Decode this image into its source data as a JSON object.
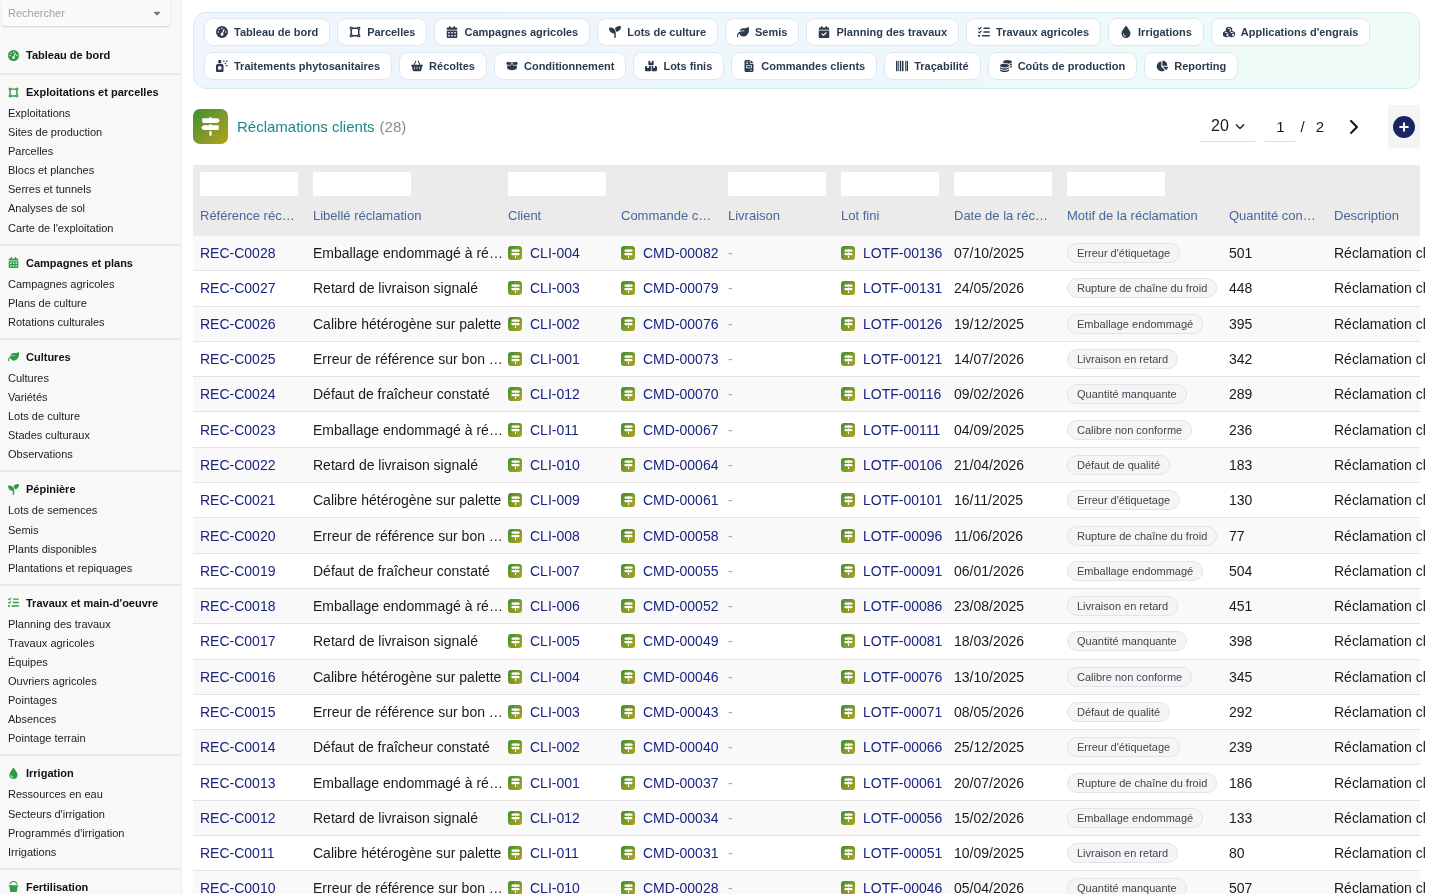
{
  "sidebar": {
    "search": {
      "placeholder": "Rechercher"
    },
    "sections": [
      {
        "title": "Tableau de bord"
      },
      {
        "title": "Exploitations et parcelles",
        "items": [
          {
            "label": "Exploitations",
            "selected": false
          },
          {
            "label": "Sites de production",
            "selected": false
          },
          {
            "label": "Parcelles",
            "selected": false
          },
          {
            "label": "Blocs et planches",
            "selected": false
          },
          {
            "label": "Serres et tunnels",
            "selected": false
          },
          {
            "label": "Analyses de sol",
            "selected": false
          },
          {
            "label": "Carte de l'exploitation",
            "selected": false
          }
        ]
      },
      {
        "title": "Campagnes et plans",
        "items": [
          {
            "label": "Campagnes agricoles",
            "selected": false
          },
          {
            "label": "Plans de culture",
            "selected": false
          },
          {
            "label": "Rotations culturales",
            "selected": false
          }
        ]
      },
      {
        "title": "Cultures",
        "items": [
          {
            "label": "Cultures",
            "selected": false
          },
          {
            "label": "Variétés",
            "selected": false
          },
          {
            "label": "Lots de culture",
            "selected": false
          },
          {
            "label": "Stades culturaux",
            "selected": false
          },
          {
            "label": "Observations",
            "selected": false
          }
        ]
      },
      {
        "title": "Pépinière",
        "items": [
          {
            "label": "Lots de semences",
            "selected": false
          },
          {
            "label": "Semis",
            "selected": false
          },
          {
            "label": "Plants disponibles",
            "selected": false
          },
          {
            "label": "Plantations et repiquages",
            "selected": false
          }
        ]
      },
      {
        "title": "Travaux et main-d'oeuvre",
        "items": [
          {
            "label": "Planning des travaux",
            "selected": false
          },
          {
            "label": "Travaux agricoles",
            "selected": false
          },
          {
            "label": "Équipes",
            "selected": false
          },
          {
            "label": "Ouvriers agricoles",
            "selected": false
          },
          {
            "label": "Pointages",
            "selected": false
          },
          {
            "label": "Absences",
            "selected": false
          },
          {
            "label": "Pointage terrain",
            "selected": false
          }
        ]
      },
      {
        "title": "Irrigation",
        "items": [
          {
            "label": "Ressources en eau",
            "selected": false
          },
          {
            "label": "Secteurs d'irrigation",
            "selected": false
          },
          {
            "label": "Programmés d'irrigation",
            "selected": false
          },
          {
            "label": "Irrigations",
            "selected": false
          }
        ]
      },
      {
        "title": "Fertilisation"
      }
    ]
  },
  "module_tabs": {
    "rows": [
      {
        "tabs": [
          {
            "label": "Tableau de bord",
            "selected": false
          },
          {
            "label": "Parcelles",
            "selected": false
          },
          {
            "label": "Campagnes agricoles",
            "selected": false
          },
          {
            "label": "Lots de culture",
            "selected": false
          },
          {
            "label": "Semis",
            "selected": false
          },
          {
            "label": "Planning des travaux",
            "selected": false
          },
          {
            "label": "Travaux agricoles",
            "selected": false
          },
          {
            "label": "Irrigations",
            "selected": false
          },
          {
            "label": "Applications d'engrais",
            "selected": false
          }
        ]
      },
      {
        "tabs": [
          {
            "label": "Traitements phytosanitaires",
            "selected": false
          },
          {
            "label": "Récoltes",
            "selected": false
          },
          {
            "label": "Conditionnement",
            "selected": false
          },
          {
            "label": "Lots finis",
            "selected": false
          },
          {
            "label": "Commandes clients",
            "selected": false
          },
          {
            "label": "Traçabilité",
            "selected": false
          },
          {
            "label": "Coûts de production",
            "selected": false
          },
          {
            "label": "Reporting",
            "selected": false
          }
        ]
      }
    ]
  },
  "page_header": {
    "title": "Réclamations clients",
    "count": "(28)"
  },
  "pagination": {
    "page_size": "20",
    "current_page": "1",
    "separator": "/",
    "total_pages": "2"
  },
  "table": {
    "columns": [
      {
        "label": "Référence réc…",
        "filter": true
      },
      {
        "label": "Libellé réclamation",
        "filter": true
      },
      {
        "label": "Client",
        "filter": true
      },
      {
        "label": "Commande c…",
        "filter": false
      },
      {
        "label": "Livraison",
        "filter": true
      },
      {
        "label": "Lot fini",
        "filter": true
      },
      {
        "label": "Date de la réc…",
        "filter": true
      },
      {
        "label": "Motif de la réclamation",
        "filter": true
      },
      {
        "label": "Quantité con…",
        "filter": false
      },
      {
        "label": "Description",
        "filter": false
      }
    ],
    "rows": [
      {
        "reference": "REC-C0028",
        "label": "Emballage endommagé à ré…",
        "client": "CLI-004",
        "order": "CMD-00082",
        "delivery": "-",
        "lot": "LOTF-00136",
        "date": "07/10/2025",
        "reason": "Erreur d'étiquetage",
        "quantity": "501",
        "description": "Réclamation cl"
      },
      {
        "reference": "REC-C0027",
        "label": "Retard de livraison signalé",
        "client": "CLI-003",
        "order": "CMD-00079",
        "delivery": "-",
        "lot": "LOTF-00131",
        "date": "24/05/2026",
        "reason": "Rupture de chaîne du froid",
        "quantity": "448",
        "description": "Réclamation cl"
      },
      {
        "reference": "REC-C0026",
        "label": "Calibre hétérogène sur palette",
        "client": "CLI-002",
        "order": "CMD-00076",
        "delivery": "-",
        "lot": "LOTF-00126",
        "date": "19/12/2025",
        "reason": "Emballage endommagé",
        "quantity": "395",
        "description": "Réclamation cl"
      },
      {
        "reference": "REC-C0025",
        "label": "Erreur de référence sur bon …",
        "client": "CLI-001",
        "order": "CMD-00073",
        "delivery": "-",
        "lot": "LOTF-00121",
        "date": "14/07/2026",
        "reason": "Livraison en retard",
        "quantity": "342",
        "description": "Réclamation cl"
      },
      {
        "reference": "REC-C0024",
        "label": "Défaut de fraîcheur constaté",
        "client": "CLI-012",
        "order": "CMD-00070",
        "delivery": "-",
        "lot": "LOTF-00116",
        "date": "09/02/2026",
        "reason": "Quantité manquante",
        "quantity": "289",
        "description": "Réclamation cl"
      },
      {
        "reference": "REC-C0023",
        "label": "Emballage endommagé à ré…",
        "client": "CLI-011",
        "order": "CMD-00067",
        "delivery": "-",
        "lot": "LOTF-00111",
        "date": "04/09/2025",
        "reason": "Calibre non conforme",
        "quantity": "236",
        "description": "Réclamation cl"
      },
      {
        "reference": "REC-C0022",
        "label": "Retard de livraison signalé",
        "client": "CLI-010",
        "order": "CMD-00064",
        "delivery": "-",
        "lot": "LOTF-00106",
        "date": "21/04/2026",
        "reason": "Défaut de qualité",
        "quantity": "183",
        "description": "Réclamation cl"
      },
      {
        "reference": "REC-C0021",
        "label": "Calibre hétérogène sur palette",
        "client": "CLI-009",
        "order": "CMD-00061",
        "delivery": "-",
        "lot": "LOTF-00101",
        "date": "16/11/2025",
        "reason": "Erreur d'étiquetage",
        "quantity": "130",
        "description": "Réclamation cl"
      },
      {
        "reference": "REC-C0020",
        "label": "Erreur de référence sur bon …",
        "client": "CLI-008",
        "order": "CMD-00058",
        "delivery": "-",
        "lot": "LOTF-00096",
        "date": "11/06/2026",
        "reason": "Rupture de chaîne du froid",
        "quantity": "77",
        "description": "Réclamation cl"
      },
      {
        "reference": "REC-C0019",
        "label": "Défaut de fraîcheur constaté",
        "client": "CLI-007",
        "order": "CMD-00055",
        "delivery": "-",
        "lot": "LOTF-00091",
        "date": "06/01/2026",
        "reason": "Emballage endommagé",
        "quantity": "504",
        "description": "Réclamation cl"
      },
      {
        "reference": "REC-C0018",
        "label": "Emballage endommagé à ré…",
        "client": "CLI-006",
        "order": "CMD-00052",
        "delivery": "-",
        "lot": "LOTF-00086",
        "date": "23/08/2025",
        "reason": "Livraison en retard",
        "quantity": "451",
        "description": "Réclamation cl"
      },
      {
        "reference": "REC-C0017",
        "label": "Retard de livraison signalé",
        "client": "CLI-005",
        "order": "CMD-00049",
        "delivery": "-",
        "lot": "LOTF-00081",
        "date": "18/03/2026",
        "reason": "Quantité manquante",
        "quantity": "398",
        "description": "Réclamation cl"
      },
      {
        "reference": "REC-C0016",
        "label": "Calibre hétérogène sur palette",
        "client": "CLI-004",
        "order": "CMD-00046",
        "delivery": "-",
        "lot": "LOTF-00076",
        "date": "13/10/2025",
        "reason": "Calibre non conforme",
        "quantity": "345",
        "description": "Réclamation cl"
      },
      {
        "reference": "REC-C0015",
        "label": "Erreur de référence sur bon …",
        "client": "CLI-003",
        "order": "CMD-00043",
        "delivery": "-",
        "lot": "LOTF-00071",
        "date": "08/05/2026",
        "reason": "Défaut de qualité",
        "quantity": "292",
        "description": "Réclamation cl"
      },
      {
        "reference": "REC-C0014",
        "label": "Défaut de fraîcheur constaté",
        "client": "CLI-002",
        "order": "CMD-00040",
        "delivery": "-",
        "lot": "LOTF-00066",
        "date": "25/12/2025",
        "reason": "Erreur d'étiquetage",
        "quantity": "239",
        "description": "Réclamation cl"
      },
      {
        "reference": "REC-C0013",
        "label": "Emballage endommagé à ré…",
        "client": "CLI-001",
        "order": "CMD-00037",
        "delivery": "-",
        "lot": "LOTF-00061",
        "date": "20/07/2026",
        "reason": "Rupture de chaîne du froid",
        "quantity": "186",
        "description": "Réclamation cl"
      },
      {
        "reference": "REC-C0012",
        "label": "Retard de livraison signalé",
        "client": "CLI-012",
        "order": "CMD-00034",
        "delivery": "-",
        "lot": "LOTF-00056",
        "date": "15/02/2026",
        "reason": "Emballage endommagé",
        "quantity": "133",
        "description": "Réclamation cl"
      },
      {
        "reference": "REC-C0011",
        "label": "Calibre hétérogène sur palette",
        "client": "CLI-011",
        "order": "CMD-00031",
        "delivery": "-",
        "lot": "LOTF-00051",
        "date": "10/09/2025",
        "reason": "Livraison en retard",
        "quantity": "80",
        "description": "Réclamation cl"
      },
      {
        "reference": "REC-C0010",
        "label": "Erreur de référence sur bon …",
        "client": "CLI-010",
        "order": "CMD-00028",
        "delivery": "-",
        "lot": "LOTF-00046",
        "date": "05/04/2026",
        "reason": "Quantité manquante",
        "quantity": "507",
        "description": "Réclamation cl"
      }
    ]
  }
}
